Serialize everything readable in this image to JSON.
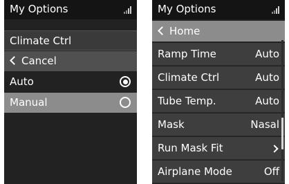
{
  "left": {
    "status_title": "My Options",
    "header": "Climate Ctrl",
    "back_label": "Cancel",
    "options": [
      {
        "label": "Auto",
        "selected": true
      },
      {
        "label": "Manual",
        "selected": false
      }
    ]
  },
  "right": {
    "status_title": "My Options",
    "back_label": "Home",
    "items": [
      {
        "label": "Ramp Time",
        "value": "Auto"
      },
      {
        "label": "Climate Ctrl",
        "value": "Auto"
      },
      {
        "label": "Tube Temp.",
        "value": "Auto"
      },
      {
        "label": "Mask",
        "value": "Nasal"
      },
      {
        "label": "Run Mask Fit",
        "value": ""
      },
      {
        "label": "Airplane Mode",
        "value": "Off"
      }
    ]
  },
  "icons": {
    "signal": "signal-strength-icon",
    "back": "chevron-left-icon",
    "forward": "chevron-right-icon",
    "radio": "radio-button-icon"
  },
  "colors": {
    "screen_bg": "#222222",
    "status_bg": "#141414",
    "row_bg": "#3e3e3e",
    "selected_bg": "#8c8c8c",
    "text": "#ffffff"
  }
}
